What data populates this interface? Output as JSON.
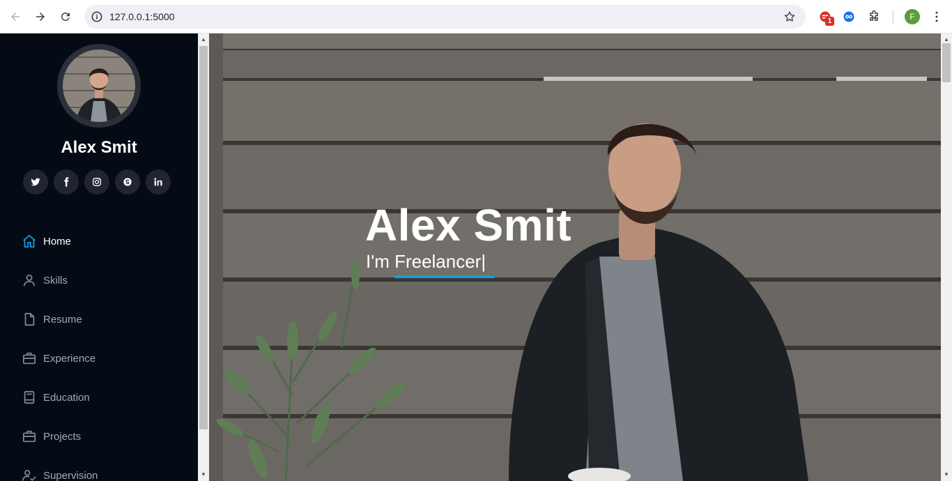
{
  "browser": {
    "url": "127.0.0.1:5000",
    "extension_badge": "1",
    "profile_initial": "F"
  },
  "sidebar": {
    "name": "Alex Smit",
    "socials": [
      {
        "icon": "twitter-icon"
      },
      {
        "icon": "facebook-icon"
      },
      {
        "icon": "instagram-icon"
      },
      {
        "icon": "skype-icon"
      },
      {
        "icon": "linkedin-icon"
      }
    ],
    "menu": [
      {
        "label": "Home",
        "icon": "home-icon",
        "active": true
      },
      {
        "label": "Skills",
        "icon": "user-icon"
      },
      {
        "label": "Resume",
        "icon": "file-icon"
      },
      {
        "label": "Experience",
        "icon": "briefcase-icon"
      },
      {
        "label": "Education",
        "icon": "book-icon"
      },
      {
        "label": "Projects",
        "icon": "briefcase-icon"
      },
      {
        "label": "Supervision",
        "icon": "user-check-icon"
      }
    ]
  },
  "hero": {
    "title": "Alex Smit",
    "subtitle": "I'm Freelancer|"
  },
  "colors": {
    "accent": "#149ddd",
    "sidebar_bg": "#040b14",
    "social_bg": "#212431"
  }
}
